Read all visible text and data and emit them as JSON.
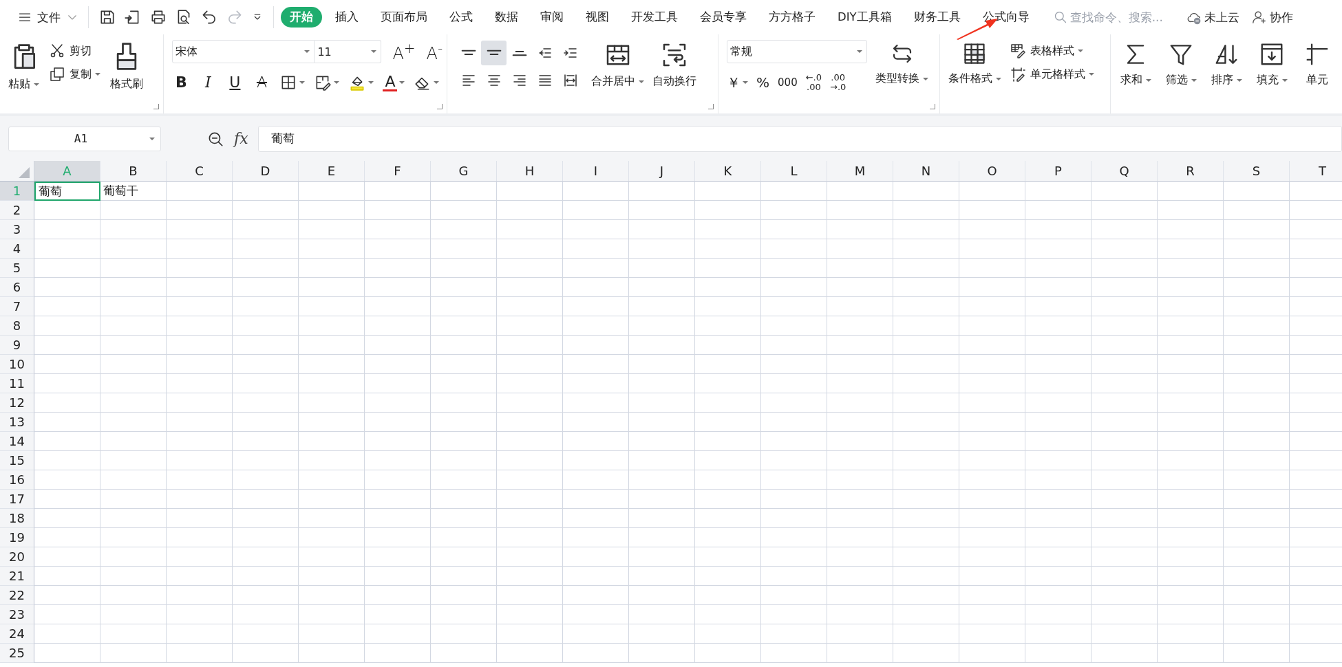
{
  "menu": {
    "label": "文件"
  },
  "quick_access": [
    {
      "kind": "save",
      "disabled": false
    },
    {
      "kind": "export",
      "disabled": false
    },
    {
      "kind": "print",
      "disabled": false
    },
    {
      "kind": "preview",
      "disabled": false
    },
    {
      "kind": "undo",
      "disabled": false
    },
    {
      "kind": "redo",
      "disabled": true
    },
    {
      "kind": "customize",
      "disabled": false
    }
  ],
  "tabs": [
    {
      "label": "开始",
      "selected": true
    },
    {
      "label": "插入",
      "selected": false
    },
    {
      "label": "页面布局",
      "selected": false
    },
    {
      "label": "公式",
      "selected": false
    },
    {
      "label": "数据",
      "selected": false
    },
    {
      "label": "审阅",
      "selected": false
    },
    {
      "label": "视图",
      "selected": false
    },
    {
      "label": "开发工具",
      "selected": false
    },
    {
      "label": "会员专享",
      "selected": false
    },
    {
      "label": "方方格子",
      "selected": false
    },
    {
      "label": "DIY工具箱",
      "selected": false
    },
    {
      "label": "财务工具",
      "selected": false
    },
    {
      "label": "公式向导",
      "selected": false
    }
  ],
  "search": {
    "placeholder": "查找命令、搜索..."
  },
  "cloud": {
    "label": "未上云"
  },
  "collaborate": {
    "label": "协作"
  },
  "clipboard": {
    "paste": "粘贴",
    "cut": "剪切",
    "copy": "复制",
    "format_painter": "格式刷"
  },
  "font": {
    "name": "宋体",
    "size": "11",
    "grow": "A$^{+}$",
    "shrink": "A$^{-}$",
    "styles": [
      {
        "kind": "bold",
        "label": "B"
      },
      {
        "kind": "italic",
        "label": "I"
      },
      {
        "kind": "underline",
        "label": "U"
      },
      {
        "kind": "strike",
        "label": "A"
      }
    ],
    "tools": [
      {
        "kind": "border"
      },
      {
        "kind": "cell-style"
      },
      {
        "kind": "fill"
      },
      {
        "kind": "font-color",
        "label": "A"
      },
      {
        "kind": "eraser"
      }
    ]
  },
  "alignment": {
    "buttons": [
      {
        "kind": "top",
        "selected": false
      },
      {
        "kind": "middle",
        "selected": true
      },
      {
        "kind": "bottom",
        "selected": false
      },
      {
        "kind": "outdent",
        "selected": false
      },
      {
        "kind": "indent",
        "selected": false
      },
      {
        "kind": "left",
        "selected": false
      },
      {
        "kind": "center",
        "selected": false
      },
      {
        "kind": "right",
        "selected": false
      },
      {
        "kind": "justify",
        "selected": false
      },
      {
        "kind": "distributed",
        "selected": false
      }
    ],
    "merge": "合并居中",
    "wrap": "自动换行"
  },
  "number": {
    "format": "常规",
    "buttons": [
      {
        "kind": "currency",
        "lines": [
          "￥"
        ]
      },
      {
        "kind": "percent",
        "lines": [
          "%"
        ]
      },
      {
        "kind": "thousands",
        "lines": [
          "000"
        ]
      },
      {
        "kind": "increase-decimal",
        "lines": [
          "←.0",
          ".00"
        ]
      },
      {
        "kind": "decrease-decimal",
        "lines": [
          ".00",
          "→.0"
        ]
      }
    ],
    "convert": "类型转换"
  },
  "styles": {
    "conditional": "条件格式",
    "table_style": "表格样式",
    "cell_style": "单元格样式"
  },
  "editing": [
    {
      "kind": "sum",
      "label": "求和"
    },
    {
      "kind": "filter",
      "label": "筛选"
    },
    {
      "kind": "sort",
      "label": "排序"
    },
    {
      "kind": "fill",
      "label": "填充"
    },
    {
      "kind": "cell",
      "label": "单元"
    }
  ],
  "formula_bar": {
    "name_box": "A1",
    "function_label": "fx",
    "value": "葡萄"
  },
  "sheet": {
    "columns": [
      {
        "label": "A",
        "selected": true
      },
      {
        "label": "B",
        "selected": false
      },
      {
        "label": "C",
        "selected": false
      },
      {
        "label": "D",
        "selected": false
      },
      {
        "label": "E",
        "selected": false
      },
      {
        "label": "F",
        "selected": false
      },
      {
        "label": "G",
        "selected": false
      },
      {
        "label": "H",
        "selected": false
      },
      {
        "label": "I",
        "selected": false
      },
      {
        "label": "J",
        "selected": false
      },
      {
        "label": "K",
        "selected": false
      },
      {
        "label": "L",
        "selected": false
      },
      {
        "label": "M",
        "selected": false
      },
      {
        "label": "N",
        "selected": false
      },
      {
        "label": "O",
        "selected": false
      },
      {
        "label": "P",
        "selected": false
      },
      {
        "label": "Q",
        "selected": false
      },
      {
        "label": "R",
        "selected": false
      },
      {
        "label": "S",
        "selected": false
      },
      {
        "label": "T",
        "selected": false
      }
    ],
    "rows": [
      {
        "label": "1",
        "selected": true,
        "cells": [
          {
            "text": "葡萄",
            "selected": true
          },
          {
            "text": "葡萄干",
            "selected": false
          }
        ]
      },
      {
        "label": "2",
        "selected": false
      },
      {
        "label": "3",
        "selected": false
      },
      {
        "label": "4",
        "selected": false
      },
      {
        "label": "5",
        "selected": false
      },
      {
        "label": "6",
        "selected": false
      },
      {
        "label": "7",
        "selected": false
      },
      {
        "label": "8",
        "selected": false
      },
      {
        "label": "9",
        "selected": false
      },
      {
        "label": "10",
        "selected": false
      },
      {
        "label": "11",
        "selected": false
      },
      {
        "label": "12",
        "selected": false
      },
      {
        "label": "13",
        "selected": false
      },
      {
        "label": "14",
        "selected": false
      },
      {
        "label": "15",
        "selected": false
      },
      {
        "label": "16",
        "selected": false
      },
      {
        "label": "17",
        "selected": false
      },
      {
        "label": "18",
        "selected": false
      },
      {
        "label": "19",
        "selected": false
      },
      {
        "label": "20",
        "selected": false
      },
      {
        "label": "21",
        "selected": false
      },
      {
        "label": "22",
        "selected": false
      },
      {
        "label": "23",
        "selected": false
      },
      {
        "label": "24",
        "selected": false
      },
      {
        "label": "25",
        "selected": false
      }
    ]
  },
  "annotations": [
    {
      "kind": "arrow"
    }
  ]
}
